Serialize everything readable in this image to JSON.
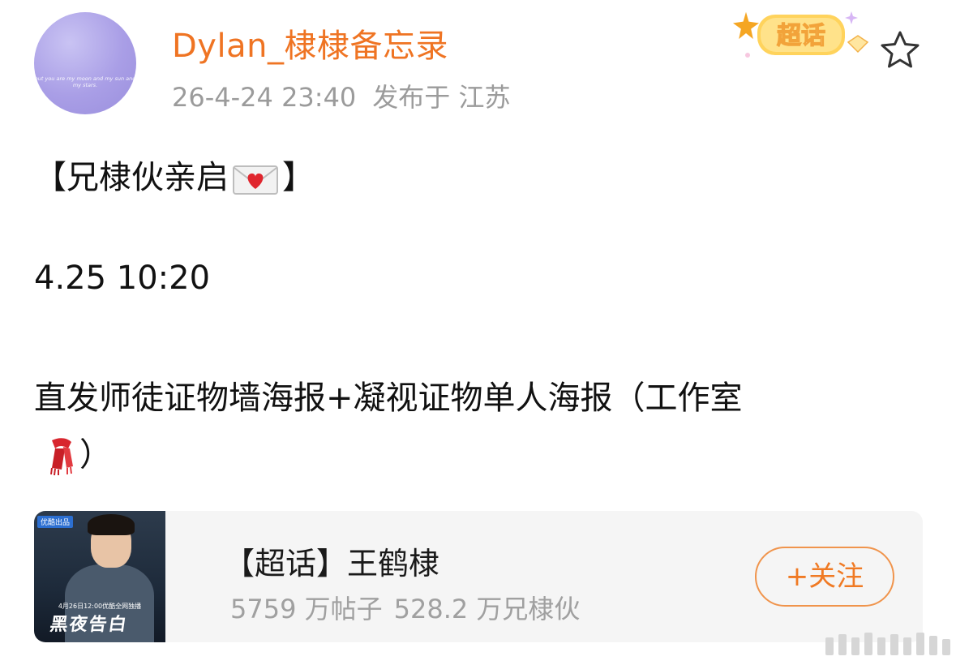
{
  "post": {
    "author": "Dylan_棣棣备忘录",
    "timestamp": "26-4-24 23:40",
    "published_from": "发布于 江苏",
    "avatar_quote": "but you are my moon and my sun and my stars.",
    "badge_label": "超话",
    "lines": {
      "line1_prefix": "【兄棣伙亲启",
      "line1_suffix": "】",
      "line2": "4.25  10:20",
      "line3": "直发师徒证物墙海报+凝视证物单人海报（工作室",
      "line4_suffix": "）"
    },
    "icons": {
      "envelope": "love-letter-icon",
      "scarf": "scarf-icon",
      "favorite": "star-outline-icon"
    }
  },
  "card": {
    "title": "【超话】王鹤棣",
    "posts_count": "5759 万帖子",
    "members_count": "528.2 万兄棣伙",
    "follow_label": "+关注",
    "thumb_tag": "优酷出品",
    "thumb_date": "4月26日12:00优酷全网独播",
    "thumb_title": "黑夜告白"
  },
  "colors": {
    "username": "#ef7423",
    "meta": "#9b9b9b",
    "follow_border": "#f0944c",
    "card_bg": "#f5f5f5"
  }
}
